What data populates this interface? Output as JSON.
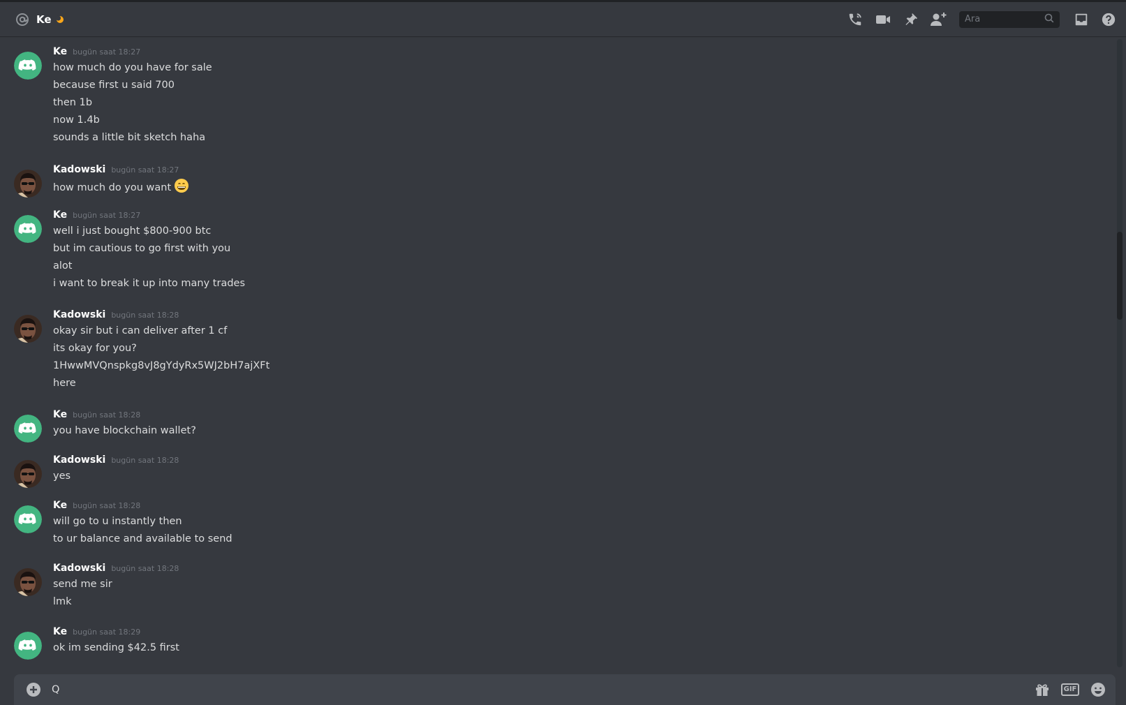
{
  "header": {
    "title": "Ke",
    "search_placeholder": "Ara",
    "status_icon": "moon-idle-icon",
    "icons": [
      "call-icon",
      "video-icon",
      "pin-icon",
      "add-friend-icon",
      "inbox-icon",
      "help-icon"
    ]
  },
  "messages": [
    {
      "author": "Ke",
      "avatar": "discord-default-avatar",
      "timestamp": "bugün saat 18:27",
      "lines": [
        "how much do you have for sale",
        "because first u said 700",
        "then 1b",
        "now 1.4b",
        "sounds a little bit sketch haha"
      ]
    },
    {
      "author": "Kadowski",
      "avatar": "user-photo-avatar",
      "timestamp": "bugün saat 18:27",
      "lines": [
        "how much do you want"
      ],
      "emoji": "grinning-face-emoji"
    },
    {
      "author": "Ke",
      "avatar": "discord-default-avatar",
      "timestamp": "bugün saat 18:27",
      "lines": [
        "well i just bought $800-900 btc",
        "but im cautious to go first with you",
        "alot",
        "i want to break it up into many trades"
      ]
    },
    {
      "author": "Kadowski",
      "avatar": "user-photo-avatar",
      "timestamp": "bugün saat 18:28",
      "lines": [
        "okay sir but i can deliver after 1 cf",
        "its okay for you?",
        "1HwwMVQnspkg8vJ8gYdyRx5WJ2bH7ajXFt",
        "here"
      ]
    },
    {
      "author": "Ke",
      "avatar": "discord-default-avatar",
      "timestamp": "bugün saat 18:28",
      "lines": [
        "you have blockchain wallet?"
      ]
    },
    {
      "author": "Kadowski",
      "avatar": "user-photo-avatar",
      "timestamp": "bugün saat 18:28",
      "lines": [
        "yes"
      ]
    },
    {
      "author": "Ke",
      "avatar": "discord-default-avatar",
      "timestamp": "bugün saat 18:28",
      "lines": [
        "will go to u instantly then",
        "to ur balance and available to send"
      ]
    },
    {
      "author": "Kadowski",
      "avatar": "user-photo-avatar",
      "timestamp": "bugün saat 18:28",
      "lines": [
        "send me sir",
        "lmk"
      ]
    },
    {
      "author": "Ke",
      "avatar": "discord-default-avatar",
      "timestamp": "bugün saat 18:29",
      "lines": [
        "ok im sending $42.5 first"
      ]
    }
  ],
  "composer": {
    "value": "Q",
    "icons": [
      "plus-circle-icon",
      "gift-icon",
      "gif-icon",
      "emoji-icon"
    ],
    "gif_label": "GIF"
  },
  "colors": {
    "background": "#36393f",
    "discord_green": "#43b581",
    "text": "#dcddde",
    "muted": "#72767d"
  }
}
